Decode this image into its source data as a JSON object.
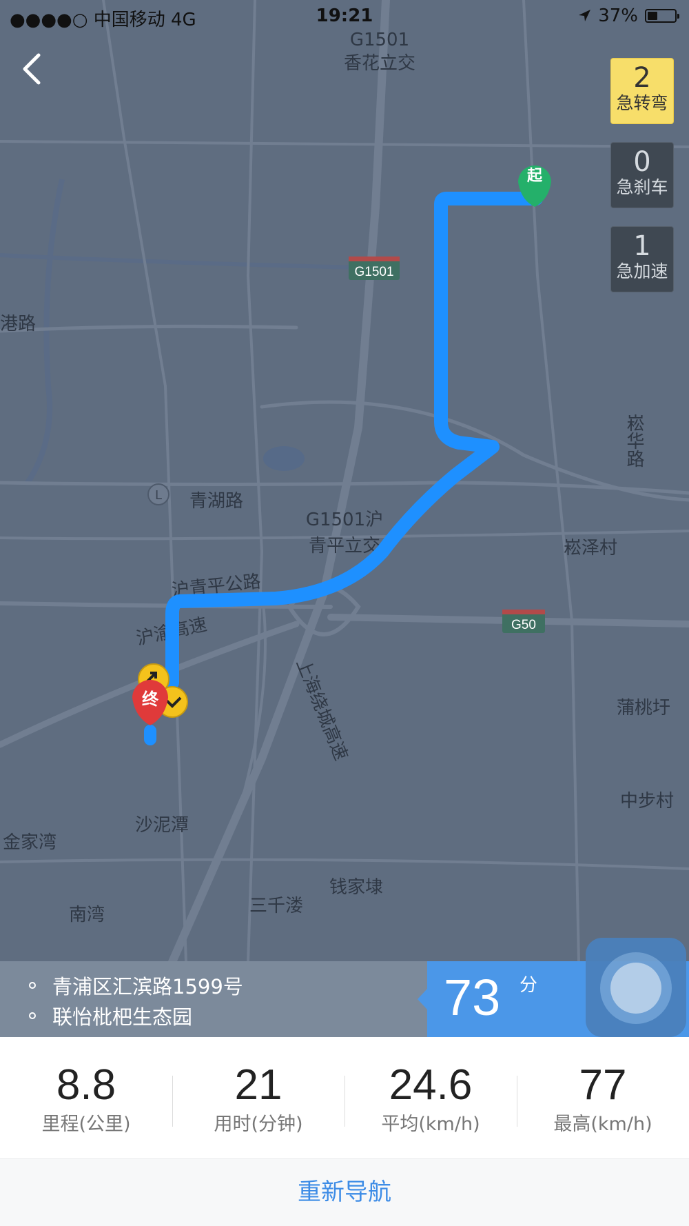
{
  "status_bar": {
    "carrier": "●●●●○ 中国移动  4G",
    "time": "19:21",
    "battery_text": "37%",
    "battery_level": 0.37
  },
  "badges": [
    {
      "value": "2",
      "label": "急转弯",
      "highlighted": true
    },
    {
      "value": "0",
      "label": "急刹车",
      "highlighted": false
    },
    {
      "value": "1",
      "label": "急加速",
      "highlighted": false
    }
  ],
  "map": {
    "colors": {
      "background": "#5f6d80",
      "road": "#738094",
      "route": "#1e90ff",
      "start": "#24b06a",
      "end": "#e03a3a"
    },
    "labels": {
      "g1501_top": "G1501",
      "interchange_top": "香花立交",
      "shield_g1501": "G1501",
      "gangl_road": "港路",
      "songhua_road": "崧华路",
      "qinghu_road": "青湖路",
      "interchange_mid_1": "G1501沪",
      "interchange_mid_2": "青平立交",
      "songze_village": "崧泽村",
      "hqp_highway": "沪青平公路",
      "hy_highway": "沪渝高速",
      "shield_g50": "G50",
      "ring_expressway": "上海绕城高速",
      "putaoyu": "蒲桃圩",
      "zhongbu_village": "中步村",
      "shanitan": "沙泥潭",
      "jinjiawan": "金家湾",
      "qianjiadai": "钱家埭",
      "sanqianlou": "三千溇",
      "nanwan": "南湾"
    },
    "start_marker": "起",
    "end_marker": "终"
  },
  "addresses": {
    "from": "青浦区汇滨路1599号",
    "to": "联怡枇杷生态园"
  },
  "duration": {
    "value": "73",
    "unit": "分"
  },
  "stats": [
    {
      "value": "8.8",
      "label": "里程(公里)"
    },
    {
      "value": "21",
      "label": "用时(分钟)"
    },
    {
      "value": "24.6",
      "label": "平均(km/h)"
    },
    {
      "value": "77",
      "label": "最高(km/h)"
    }
  ],
  "renavigate_label": "重新导航"
}
